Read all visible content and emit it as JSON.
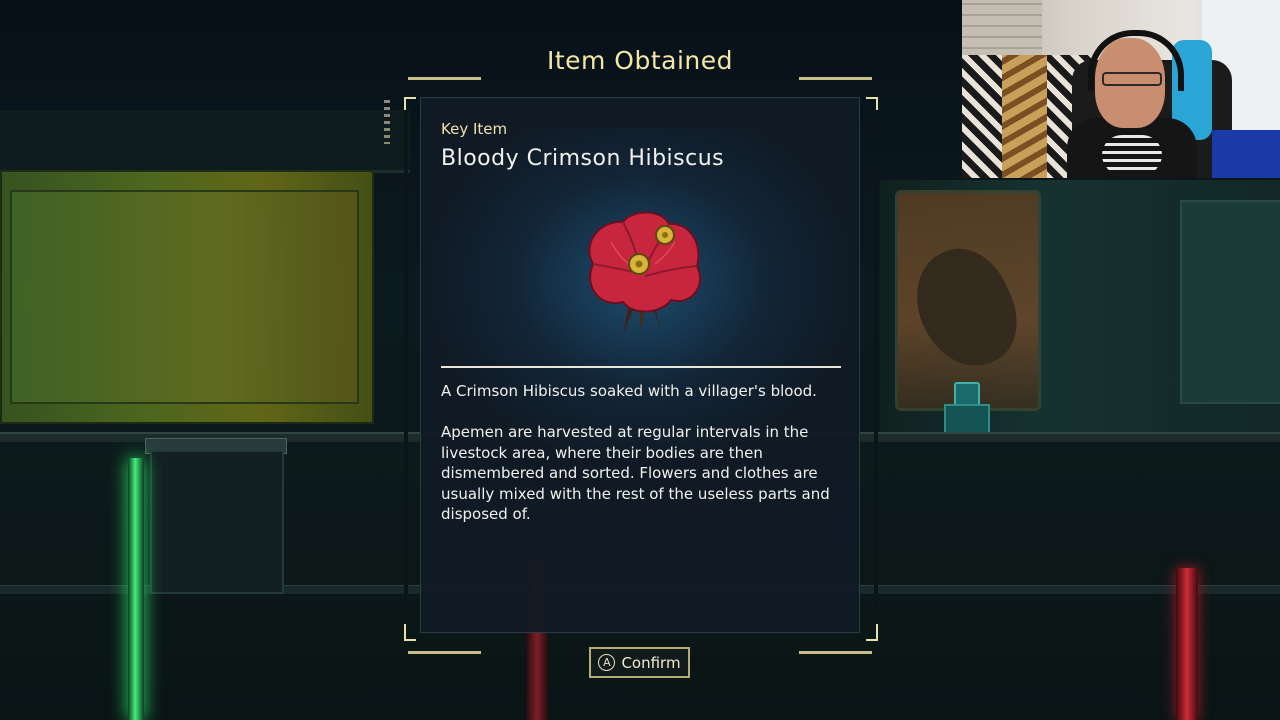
{
  "modal": {
    "title": "Item Obtained",
    "category": "Key Item",
    "item_name": "Bloody Crimson Hibiscus",
    "description_short": "A Crimson Hibiscus soaked with a villager's blood.",
    "description_long": "Apemen are harvested at regular intervals in the livestock area, where their bodies are then dismembered and sorted. Flowers and clothes are usually mixed with the rest of the useless parts and disposed of.",
    "item_icon": "hibiscus-flower-icon"
  },
  "confirm": {
    "button_glyph": "A",
    "label": "Confirm"
  },
  "colors": {
    "title": "#f3e6a6",
    "frame": "#e8e0a8",
    "panel": "#111b25",
    "flower": "#c8263e"
  }
}
